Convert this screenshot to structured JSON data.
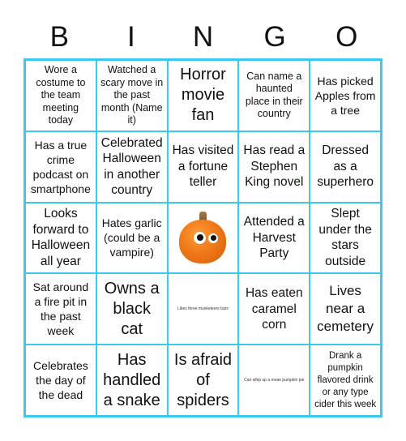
{
  "title_letters": [
    "B",
    "I",
    "N",
    "G",
    "O"
  ],
  "colors": {
    "grid_border": "#3cc8f0",
    "pumpkin": "#f07a18",
    "text": "#111111"
  },
  "cells": [
    [
      "Wore a costume to the team meeting today",
      "Watched a scary move in the past month (Name it)",
      "Horror movie fan",
      "Can name a haunted place in their country",
      "Has picked Apples from a tree"
    ],
    [
      "Has a true crime podcast on smartphone",
      "Celebrated Halloween in another country",
      "Has visited a fortune teller",
      "Has read a Stephen King novel",
      "Dressed as a superhero"
    ],
    [
      "Looks forward to Halloween all year",
      "Hates garlic (could be a vampire)",
      "",
      "Attended a Harvest Party",
      "Slept under the stars outside"
    ],
    [
      "Sat around a fire pit in the past week",
      "Owns a black cat",
      "Likes three musketeers bars",
      "Has eaten caramel corn",
      "Lives near a cemetery"
    ],
    [
      "Celebrates the day of the dead",
      "Has handled a snake",
      "Is afraid of spiders",
      "Can whip up a mean pumpkin pie",
      "Drank a pumpkin flavored drink or any type cider this week"
    ]
  ],
  "free_space": {
    "icon": "pumpkin-with-googly-eyes"
  }
}
